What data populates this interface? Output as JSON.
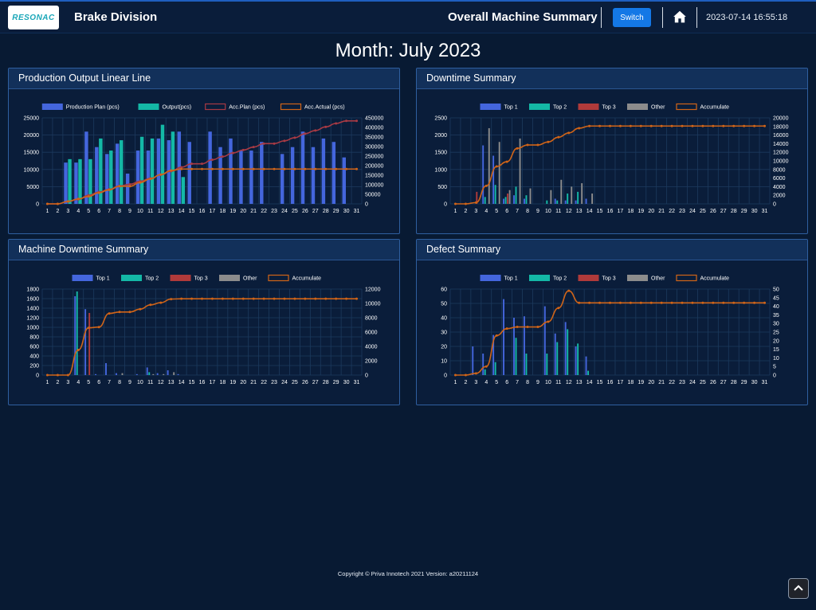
{
  "header": {
    "logo_text": "RESONAC",
    "division": "Brake Division",
    "title": "Overall Machine Summary",
    "switch_label": "Switch",
    "datetime": "2023-07-14 16:55:18",
    "home_icon": "home-icon"
  },
  "month_label": "Month: July 2023",
  "footer": "Copyright © Priva Innotech 2021 Version: a20211124",
  "colors": {
    "top1": "#4466dd",
    "top2": "#14b8a6",
    "top3": "#b03a3a",
    "other": "#8c8c8c",
    "accumulate": "#d06418",
    "plan_line": "#a83a44"
  },
  "panels": [
    {
      "title": "Production Output Linear Line",
      "chart_data": {
        "type": "bar",
        "categories": [
          "1",
          "2",
          "3",
          "4",
          "5",
          "6",
          "7",
          "8",
          "9",
          "10",
          "11",
          "12",
          "13",
          "14",
          "15",
          "16",
          "17",
          "18",
          "19",
          "20",
          "21",
          "22",
          "23",
          "24",
          "25",
          "26",
          "27",
          "28",
          "29",
          "30",
          "31"
        ],
        "ylim": [
          0,
          25000
        ],
        "yticks": [
          "0",
          "5000",
          "10000",
          "15000",
          "20000",
          "25000"
        ],
        "y2lim": [
          0,
          450000
        ],
        "y2ticks": [
          "0",
          "50000",
          "100000",
          "150000",
          "200000",
          "250000",
          "300000",
          "350000",
          "400000",
          "450000"
        ],
        "series": [
          {
            "name": "Production Plan (pcs)",
            "kind": "bar",
            "color": "#4466dd",
            "axis": "left",
            "values": [
              0,
              0,
              12000,
              12000,
              21000,
              16500,
              14500,
              17500,
              8800,
              15500,
              15500,
              19000,
              18500,
              21000,
              18000,
              0,
              21000,
              16500,
              19000,
              15500,
              15500,
              18000,
              0,
              14500,
              16500,
              21000,
              16500,
              19000,
              18000,
              13500,
              0
            ]
          },
          {
            "name": "Output(pcs)",
            "kind": "bar",
            "color": "#14b8a6",
            "axis": "left",
            "values": [
              0,
              0,
              13000,
              13000,
              13000,
              19000,
              15500,
              18500,
              0,
              19500,
              19000,
              23000,
              21000,
              7800,
              0,
              0,
              0,
              0,
              0,
              0,
              0,
              0,
              0,
              0,
              0,
              0,
              0,
              0,
              0,
              0,
              0
            ]
          },
          {
            "name": "Acc.Plan (pcs)",
            "kind": "line",
            "color": "#a83a44",
            "axis": "right",
            "values": [
              0,
              0,
              12000,
              24000,
              45000,
              61500,
              76000,
              93500,
              102300,
              117800,
              133300,
              152300,
              170800,
              191800,
              209800,
              209800,
              230800,
              247300,
              266300,
              281800,
              297300,
              315300,
              315300,
              329800,
              346300,
              367300,
              383800,
              402800,
              420800,
              434300,
              434300
            ]
          },
          {
            "name": "Acc.Actual (pcs)",
            "kind": "line",
            "color": "#d06418",
            "axis": "right",
            "values": [
              0,
              0,
              13000,
              26000,
              39000,
              58000,
              73500,
              92000,
              92000,
              111500,
              130500,
              153500,
              174500,
              182300,
              182300,
              182300,
              182300,
              182300,
              182300,
              182300,
              182300,
              182300,
              182300,
              182300,
              182300,
              182300,
              182300,
              182300,
              182300,
              182300,
              182300
            ]
          }
        ]
      }
    },
    {
      "title": "Downtime Summary",
      "chart_data": {
        "type": "bar",
        "categories": [
          "1",
          "2",
          "3",
          "4",
          "5",
          "6",
          "7",
          "8",
          "9",
          "10",
          "11",
          "12",
          "13",
          "14",
          "15",
          "16",
          "17",
          "18",
          "19",
          "20",
          "21",
          "22",
          "23",
          "24",
          "25",
          "26",
          "27",
          "28",
          "29",
          "30",
          "31"
        ],
        "ylim": [
          0,
          2500
        ],
        "yticks": [
          "0",
          "500",
          "1000",
          "1500",
          "2000",
          "2500"
        ],
        "y2lim": [
          0,
          20000
        ],
        "y2ticks": [
          "0",
          "2000",
          "4000",
          "6000",
          "8000",
          "10000",
          "12000",
          "14000",
          "16000",
          "18000",
          "20000"
        ],
        "series": [
          {
            "name": "Top 1",
            "kind": "bar",
            "color": "#4466dd",
            "axis": "left",
            "values": [
              0,
              0,
              0,
              1700,
              1400,
              150,
              250,
              150,
              0,
              0,
              150,
              100,
              100,
              150,
              0,
              0,
              0,
              0,
              0,
              0,
              0,
              0,
              0,
              0,
              0,
              0,
              0,
              0,
              0,
              0,
              0
            ]
          },
          {
            "name": "Top 2",
            "kind": "bar",
            "color": "#14b8a6",
            "axis": "left",
            "values": [
              0,
              0,
              0,
              200,
              550,
              200,
              500,
              250,
              0,
              100,
              100,
              300,
              350,
              0,
              0,
              0,
              0,
              0,
              0,
              0,
              0,
              0,
              0,
              0,
              0,
              0,
              0,
              0,
              0,
              0,
              0
            ]
          },
          {
            "name": "Top 3",
            "kind": "bar",
            "color": "#b03a3a",
            "axis": "left",
            "values": [
              0,
              0,
              350,
              0,
              0,
              300,
              0,
              0,
              0,
              0,
              0,
              0,
              0,
              0,
              0,
              0,
              0,
              0,
              0,
              0,
              0,
              0,
              0,
              0,
              0,
              0,
              0,
              0,
              0,
              0,
              0
            ]
          },
          {
            "name": "Other",
            "kind": "bar",
            "color": "#8c8c8c",
            "axis": "left",
            "values": [
              0,
              0,
              0,
              2200,
              1800,
              400,
              1900,
              450,
              0,
              400,
              700,
              500,
              600,
              300,
              0,
              0,
              0,
              0,
              0,
              0,
              0,
              0,
              0,
              0,
              0,
              0,
              0,
              0,
              0,
              0,
              0
            ]
          },
          {
            "name": "Accumulate",
            "kind": "line",
            "color": "#d06418",
            "axis": "right",
            "values": [
              0,
              0,
              300,
              4200,
              8700,
              9800,
              12900,
              13700,
              13700,
              14400,
              15500,
              16500,
              17600,
              18100,
              18100,
              18100,
              18100,
              18100,
              18100,
              18100,
              18100,
              18100,
              18100,
              18100,
              18100,
              18100,
              18100,
              18100,
              18100,
              18100,
              18100
            ]
          }
        ]
      }
    },
    {
      "title": "Machine Downtime Summary",
      "chart_data": {
        "type": "bar",
        "categories": [
          "1",
          "2",
          "3",
          "4",
          "5",
          "6",
          "7",
          "8",
          "9",
          "10",
          "11",
          "12",
          "13",
          "14",
          "15",
          "16",
          "17",
          "18",
          "19",
          "20",
          "21",
          "22",
          "23",
          "24",
          "25",
          "26",
          "27",
          "28",
          "29",
          "30",
          "31"
        ],
        "ylim": [
          0,
          1800
        ],
        "yticks": [
          "0",
          "200",
          "400",
          "600",
          "800",
          "1000",
          "1200",
          "1400",
          "1600",
          "1800"
        ],
        "y2lim": [
          0,
          12000
        ],
        "y2ticks": [
          "0",
          "2000",
          "4000",
          "6000",
          "8000",
          "10000",
          "12000"
        ],
        "series": [
          {
            "name": "Top 1",
            "kind": "bar",
            "color": "#4466dd",
            "axis": "left",
            "values": [
              0,
              0,
              0,
              1650,
              1380,
              20,
              250,
              40,
              0,
              20,
              160,
              40,
              100,
              20,
              0,
              0,
              0,
              0,
              0,
              0,
              0,
              0,
              0,
              0,
              0,
              0,
              0,
              0,
              0,
              0,
              0
            ]
          },
          {
            "name": "Top 2",
            "kind": "bar",
            "color": "#14b8a6",
            "axis": "left",
            "values": [
              0,
              0,
              0,
              1750,
              0,
              0,
              0,
              0,
              0,
              0,
              60,
              0,
              0,
              0,
              0,
              0,
              0,
              0,
              0,
              0,
              0,
              0,
              0,
              0,
              0,
              0,
              0,
              0,
              0,
              0,
              0
            ]
          },
          {
            "name": "Top 3",
            "kind": "bar",
            "color": "#b03a3a",
            "axis": "left",
            "values": [
              0,
              0,
              0,
              0,
              1300,
              0,
              0,
              0,
              0,
              0,
              0,
              0,
              0,
              0,
              0,
              0,
              0,
              0,
              0,
              0,
              0,
              0,
              0,
              0,
              0,
              0,
              0,
              0,
              0,
              0,
              0
            ]
          },
          {
            "name": "Other",
            "kind": "bar",
            "color": "#8c8c8c",
            "axis": "left",
            "values": [
              0,
              0,
              0,
              0,
              0,
              0,
              0,
              40,
              0,
              0,
              20,
              20,
              60,
              0,
              0,
              0,
              0,
              0,
              0,
              0,
              0,
              0,
              0,
              0,
              0,
              0,
              0,
              0,
              0,
              0,
              0
            ]
          },
          {
            "name": "Accumulate",
            "kind": "line",
            "color": "#d06418",
            "axis": "right",
            "values": [
              0,
              0,
              0,
              3500,
              6600,
              6700,
              8600,
              8800,
              8800,
              9200,
              9800,
              10100,
              10600,
              10650,
              10650,
              10650,
              10650,
              10650,
              10650,
              10650,
              10650,
              10650,
              10650,
              10650,
              10650,
              10650,
              10650,
              10650,
              10650,
              10650,
              10650
            ]
          }
        ]
      }
    },
    {
      "title": "Defect Summary",
      "chart_data": {
        "type": "bar",
        "categories": [
          "1",
          "2",
          "3",
          "4",
          "5",
          "6",
          "7",
          "8",
          "9",
          "10",
          "11",
          "12",
          "13",
          "14",
          "15",
          "16",
          "17",
          "18",
          "19",
          "20",
          "21",
          "22",
          "23",
          "24",
          "25",
          "26",
          "27",
          "28",
          "29",
          "30",
          "31"
        ],
        "ylim": [
          0,
          60
        ],
        "yticks": [
          "0",
          "10",
          "20",
          "30",
          "40",
          "50",
          "60"
        ],
        "y2lim": [
          0,
          50
        ],
        "y2ticks": [
          "0",
          "5",
          "10",
          "15",
          "20",
          "25",
          "30",
          "35",
          "40",
          "45",
          "50"
        ],
        "series": [
          {
            "name": "Top 1",
            "kind": "bar",
            "color": "#4466dd",
            "axis": "left",
            "values": [
              0,
              0,
              20,
              15,
              28,
              53,
              40,
              41,
              0,
              48,
              29,
              37,
              20,
              13,
              0,
              0,
              0,
              0,
              0,
              0,
              0,
              0,
              0,
              0,
              0,
              0,
              0,
              0,
              0,
              0,
              0
            ]
          },
          {
            "name": "Top 2",
            "kind": "bar",
            "color": "#14b8a6",
            "axis": "left",
            "values": [
              0,
              0,
              0,
              4,
              9,
              0,
              26,
              15,
              0,
              15,
              23,
              32,
              22,
              3,
              0,
              0,
              0,
              0,
              0,
              0,
              0,
              0,
              0,
              0,
              0,
              0,
              0,
              0,
              0,
              0,
              0
            ]
          },
          {
            "name": "Top 3",
            "kind": "bar",
            "color": "#b03a3a",
            "axis": "left",
            "values": [
              0,
              0,
              0,
              0,
              0,
              0,
              0,
              0,
              0,
              0,
              0,
              0,
              0,
              0,
              0,
              0,
              0,
              0,
              0,
              0,
              0,
              0,
              0,
              0,
              0,
              0,
              0,
              0,
              0,
              0,
              0
            ]
          },
          {
            "name": "Other",
            "kind": "bar",
            "color": "#8c8c8c",
            "axis": "left",
            "values": [
              0,
              0,
              0,
              0,
              0,
              0,
              0,
              0,
              0,
              0,
              0,
              0,
              0,
              0,
              0,
              0,
              0,
              0,
              0,
              0,
              0,
              0,
              0,
              0,
              0,
              0,
              0,
              0,
              0,
              0,
              0
            ]
          },
          {
            "name": "Accumulate",
            "kind": "line",
            "color": "#d06418",
            "axis": "right",
            "values": [
              0,
              0,
              1,
              5,
              23,
              27,
              28,
              28,
              28,
              31,
              39,
              49,
              42,
              42,
              42,
              42,
              42,
              42,
              42,
              42,
              42,
              42,
              42,
              42,
              42,
              42,
              42,
              42,
              42,
              42,
              42
            ]
          }
        ]
      }
    }
  ]
}
